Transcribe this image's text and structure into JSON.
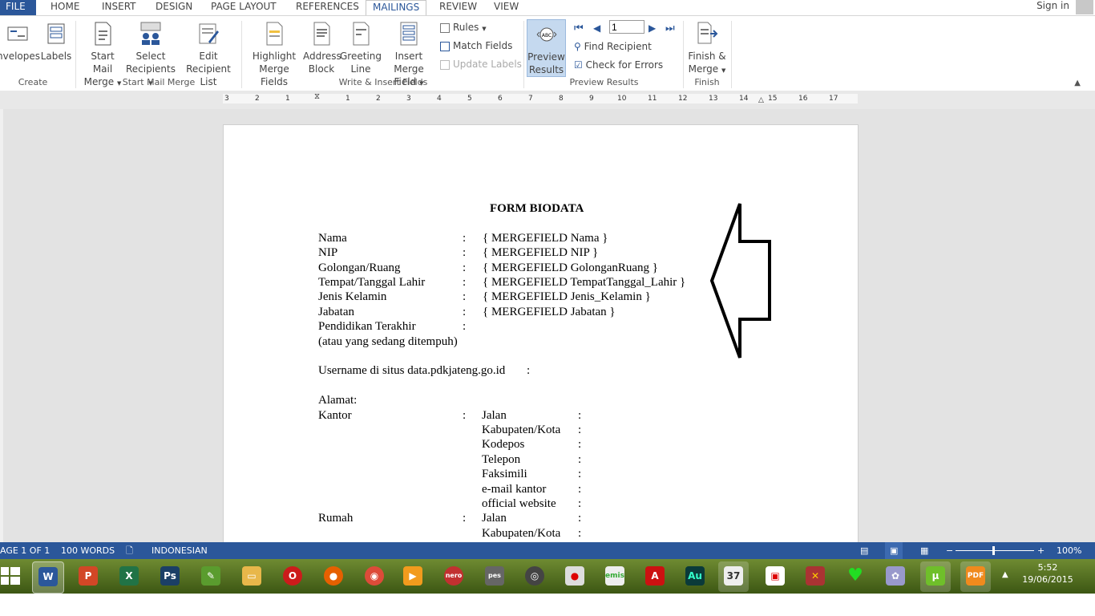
{
  "tabs": {
    "file": "FILE",
    "items": [
      "HOME",
      "INSERT",
      "DESIGN",
      "PAGE LAYOUT",
      "REFERENCES",
      "MAILINGS",
      "REVIEW",
      "VIEW"
    ],
    "active": "MAILINGS",
    "signin": "Sign in"
  },
  "ribbon": {
    "create": {
      "envelopes": "nvelopes",
      "labels": "Labels",
      "group": "Create"
    },
    "start_mail_merge": {
      "start_line1": "Start Mail",
      "start_line2": "Merge",
      "select_line1": "Select",
      "select_line2": "Recipients",
      "edit_line1": "Edit",
      "edit_line2": "Recipient List",
      "group": "Start Mail Merge"
    },
    "write_insert": {
      "highlight_line1": "Highlight",
      "highlight_line2": "Merge Fields",
      "address_line1": "Address",
      "address_line2": "Block",
      "greeting_line1": "Greeting",
      "greeting_line2": "Line",
      "insert_line1": "Insert Merge",
      "insert_line2": "Field",
      "rules": "Rules",
      "match_fields": "Match Fields",
      "update_labels": "Update Labels",
      "group": "Write & Insert Fields"
    },
    "preview": {
      "preview_line1": "Preview",
      "preview_line2": "Results",
      "record_value": "1",
      "find_recipient": "Find Recipient",
      "check_errors": "Check for Errors",
      "group": "Preview Results"
    },
    "finish": {
      "finish_line1": "Finish &",
      "finish_line2": "Merge",
      "group": "Finish"
    }
  },
  "ruler_ticks": [
    "3",
    "2",
    "1",
    "1",
    "2",
    "3",
    "4",
    "5",
    "6",
    "7",
    "8",
    "9",
    "10",
    "11",
    "12",
    "13",
    "14",
    "15",
    "16",
    "17"
  ],
  "document": {
    "title": "FORM BIODATA",
    "fields": [
      {
        "label": "Nama",
        "colon": ":",
        "value": "{ MERGEFIELD Nama }"
      },
      {
        "label": "NIP",
        "colon": ":",
        "value": "{ MERGEFIELD NIP }"
      },
      {
        "label": "Golongan/Ruang",
        "colon": ":",
        "value": "{ MERGEFIELD GolonganRuang }"
      },
      {
        "label": "Tempat/Tanggal Lahir",
        "colon": ":",
        "value": "{ MERGEFIELD TempatTanggal_Lahir }"
      },
      {
        "label": "Jenis Kelamin",
        "colon": ":",
        "value": "{ MERGEFIELD Jenis_Kelamin }"
      },
      {
        "label": "Jabatan",
        "colon": ":",
        "value": "{ MERGEFIELD Jabatan }"
      },
      {
        "label": "Pendidikan Terakhir",
        "colon": ":",
        "value": ""
      }
    ],
    "pendidikan_note": "(atau yang sedang ditempuh)",
    "username": "Username di situs data.pdkjateng.go.id",
    "username_colon": ":",
    "alamat": "Alamat:",
    "kantor": "Kantor",
    "kantor_colon": ":",
    "kantor_fields": [
      "Jalan",
      "Kabupaten/Kota",
      "Kodepos",
      "Telepon",
      "Faksimili",
      "e-mail kantor",
      "official website"
    ],
    "rumah": "Rumah",
    "rumah_colon": ":",
    "rumah_fields": [
      "Jalan",
      "Kabupaten/Kota"
    ],
    "sub_colon": ":"
  },
  "status": {
    "page": "AGE 1 OF 1",
    "words": "100 WORDS",
    "language": "INDONESIAN",
    "zoom": "100%"
  },
  "taskbar": {
    "time": "5:52",
    "date": "19/06/2015",
    "apps": [
      "word-icon",
      "powerpoint-icon",
      "excel-icon",
      "photoshop-icon",
      "corel-icon",
      "file-explorer-icon",
      "opera-icon",
      "firefox-icon",
      "chrome-icon",
      "media-player-icon",
      "nero-icon",
      "pes-icon",
      "camera-icon",
      "recorder-icon",
      "emis-icon",
      "acrobat-icon",
      "audition-icon",
      "calendar-icon",
      "presentation-icon",
      "tools-icon",
      "heart-icon",
      "paint-icon",
      "utorrent-icon",
      "pdf-icon"
    ]
  },
  "colors": {
    "word_blue": "#2b579a",
    "page_bg": "#e3e3e3",
    "taskbar": "#4f6a1d"
  }
}
